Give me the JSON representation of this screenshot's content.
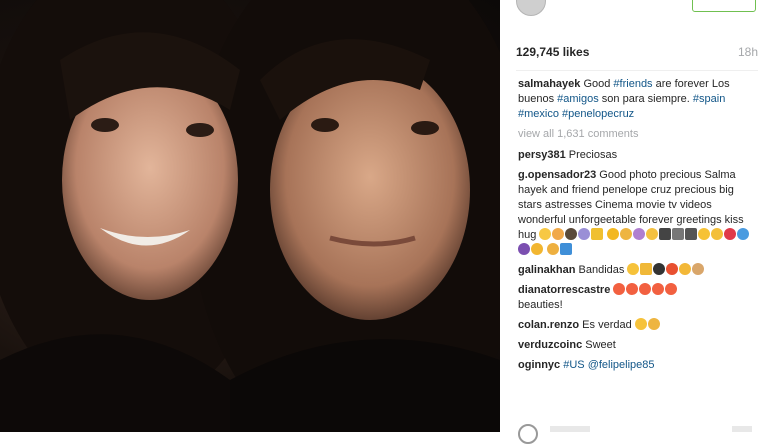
{
  "post": {
    "likes": "129,745 likes",
    "time": "18h"
  },
  "caption": {
    "user": "salmahayek",
    "text1": " Good ",
    "tag1": "#friends",
    "text2": " are forever Los buenos ",
    "tag2": "#amigos",
    "text3": " son para siempre. ",
    "tag3": "#spain #mexico #penelopecruz"
  },
  "view_all": "view all 1,631 comments",
  "comments": [
    {
      "user": "persy381",
      "text": " Preciosas"
    },
    {
      "user": "g.opensador23",
      "text": " Good photo precious Salma hayek and friend penelope cruz precious big stars astresses Cinema movie tv videos wonderful unforgeetable forever greetings kiss hug"
    },
    {
      "user": "galinakhan",
      "text": " Bandidas"
    },
    {
      "user": "dianatorrescastre",
      "text": " beauties!"
    },
    {
      "user": "colan.renzo",
      "text": " Es verdad"
    },
    {
      "user": "verduzcoinc",
      "text": " Sweet"
    },
    {
      "user": "oginnyc",
      "text": " ",
      "tag": "#US @felipelipe85"
    }
  ],
  "colors": {
    "tag": "#125688",
    "follow_border": "#70c050",
    "muted": "#a5a7aa"
  }
}
